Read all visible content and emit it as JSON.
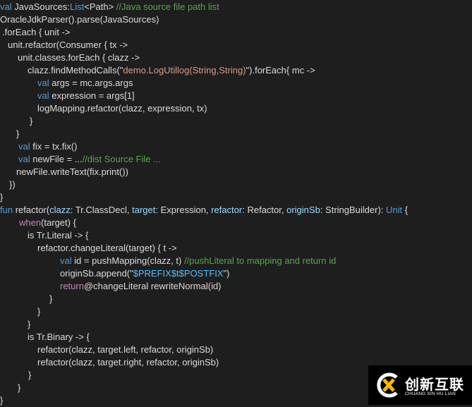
{
  "colors": {
    "background": "#1e1e1e",
    "text": "#dcdcdc",
    "keyword": "#569cd6",
    "comment": "#57a64a",
    "string": "#d69d85",
    "interpolation": "#4fc1ff",
    "parameter": "#9cdcfe",
    "control": "#c586c0"
  },
  "code": {
    "lines": [
      {
        "indent": 0,
        "tokens": [
          [
            "val",
            "kw"
          ],
          [
            " JavaSources:",
            "plain"
          ],
          [
            "List",
            "type"
          ],
          [
            "<Path> ",
            "plain"
          ],
          [
            "//Java source file path list",
            "comment"
          ]
        ]
      },
      {
        "indent": 0,
        "tokens": [
          [
            "OracleJdkParser().parse(JavaSources)",
            "plain"
          ]
        ]
      },
      {
        "indent": 3,
        "tokens": [
          [
            ".forEach { unit ->",
            "plain"
          ]
        ]
      },
      {
        "indent": 11,
        "tokens": [
          [
            "unit.refactor(Consumer { tx ->",
            "plain"
          ]
        ]
      },
      {
        "indent": 25,
        "tokens": [
          [
            "unit.classes.forEach { clazz ->",
            "plain"
          ]
        ]
      },
      {
        "indent": 39,
        "tokens": [
          [
            "clazz.findMethodCalls(\"",
            "plain"
          ],
          [
            "demo.LogUtillog(String,String)",
            "string"
          ],
          [
            "\").forEach{ mc ->",
            "plain"
          ]
        ]
      },
      {
        "indent": 53,
        "tokens": [
          [
            "val",
            "kw"
          ],
          [
            " args = mc.args.args",
            "plain"
          ]
        ]
      },
      {
        "indent": 53,
        "tokens": [
          [
            "val",
            "kw"
          ],
          [
            " expression = args[1]",
            "plain"
          ]
        ]
      },
      {
        "indent": 53,
        "tokens": [
          [
            "logMapping.refactor(clazz, expression, tx)",
            "plain"
          ]
        ]
      },
      {
        "indent": 42,
        "tokens": [
          [
            "}",
            "plain"
          ]
        ]
      },
      {
        "indent": 23,
        "tokens": [
          [
            "}",
            "plain"
          ]
        ]
      },
      {
        "indent": 26,
        "tokens": [
          [
            "val",
            "kw"
          ],
          [
            " fix = tx.fix()",
            "plain"
          ]
        ]
      },
      {
        "indent": 26,
        "tokens": [
          [
            "val",
            "kw"
          ],
          [
            " newFile = ...",
            "plain"
          ],
          [
            "//dist Source File ...",
            "comment"
          ]
        ]
      },
      {
        "indent": 23,
        "tokens": [
          [
            "newFile.writeText(fix.print())",
            "plain"
          ]
        ]
      },
      {
        "indent": 13,
        "tokens": [
          [
            "})",
            "plain"
          ]
        ]
      },
      {
        "indent": 0,
        "tokens": [
          [
            "}",
            "plain"
          ]
        ]
      },
      {
        "indent": 0,
        "tokens": [
          [
            "fun",
            "kw"
          ],
          [
            " refactor(",
            "plain"
          ],
          [
            "clazz",
            "param"
          ],
          [
            ": Tr.ClassDecl, ",
            "plain"
          ],
          [
            "target",
            "param"
          ],
          [
            ": Expression, ",
            "plain"
          ],
          [
            "refactor",
            "param"
          ],
          [
            ": Refactor, ",
            "plain"
          ],
          [
            "originSb",
            "param"
          ],
          [
            ": StringBuilder): ",
            "plain"
          ],
          [
            "Unit",
            "type"
          ],
          [
            " {",
            "plain"
          ]
        ]
      },
      {
        "indent": 27,
        "tokens": [
          [
            "when",
            "ctrl"
          ],
          [
            "(target) {",
            "plain"
          ]
        ]
      },
      {
        "indent": 39,
        "tokens": [
          [
            "is Tr.Literal -> {",
            "plain"
          ]
        ]
      },
      {
        "indent": 53,
        "tokens": [
          [
            "refactor.changeLiteral(target) { t ->",
            "plain"
          ]
        ]
      },
      {
        "indent": 85,
        "tokens": [
          [
            "val",
            "kw"
          ],
          [
            " id = pushMapping(clazz, t) ",
            "plain"
          ],
          [
            "//pushLiteral to mapping and return id",
            "comment"
          ]
        ]
      },
      {
        "indent": 85,
        "tokens": [
          [
            "originSb.append(\"",
            "plain"
          ],
          [
            "$PREFIX$t$POSTFIX",
            "interp"
          ],
          [
            "\")",
            "plain"
          ]
        ]
      },
      {
        "indent": 85,
        "tokens": [
          [
            "return",
            "ctrl"
          ],
          [
            "@changeLiteral rewriteNormal(id)",
            "plain"
          ]
        ]
      },
      {
        "indent": 70,
        "tokens": [
          [
            "}",
            "plain"
          ]
        ]
      },
      {
        "indent": 53,
        "tokens": [
          [
            "}",
            "plain"
          ]
        ]
      },
      {
        "indent": 39,
        "tokens": [
          [
            "}",
            "plain"
          ]
        ]
      },
      {
        "indent": 39,
        "tokens": [
          [
            "is Tr.Binary -> {",
            "plain"
          ]
        ]
      },
      {
        "indent": 53,
        "tokens": [
          [
            "refactor(clazz, target.left, refactor, originSb)",
            "plain"
          ]
        ]
      },
      {
        "indent": 53,
        "tokens": [
          [
            "refactor(clazz, target.right, refactor, originSb)",
            "plain"
          ]
        ]
      },
      {
        "indent": 40,
        "tokens": [
          [
            "}",
            "plain"
          ]
        ]
      },
      {
        "indent": 25,
        "tokens": [
          [
            "}",
            "plain"
          ]
        ]
      },
      {
        "indent": 0,
        "tokens": [
          [
            "}",
            "plain"
          ]
        ]
      }
    ]
  },
  "watermark": {
    "title": "创新互联",
    "subtitle": "CHUANG XIN HU LIAN",
    "logo_icon": "cx-logo-icon"
  }
}
